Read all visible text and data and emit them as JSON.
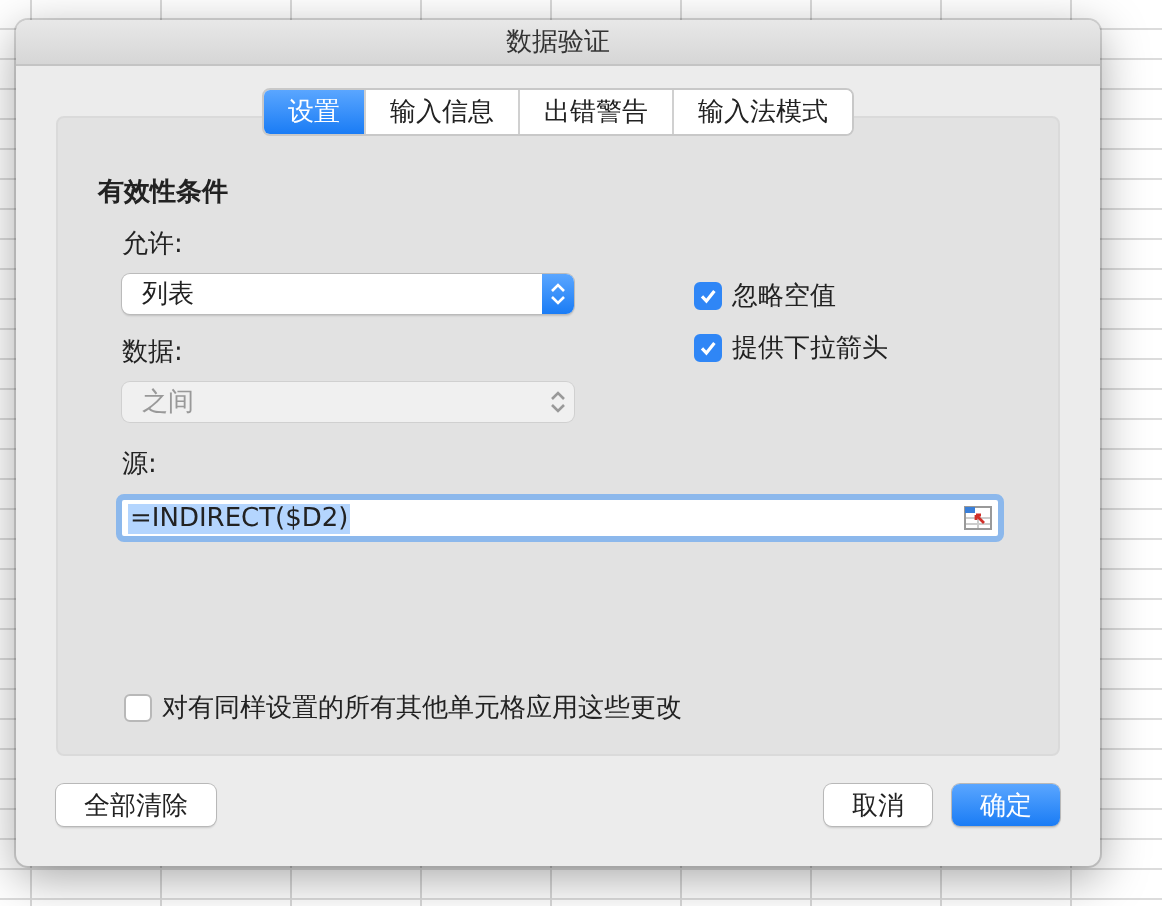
{
  "window": {
    "title": "数据验证"
  },
  "tabs": [
    {
      "label": "设置",
      "selected": true
    },
    {
      "label": "输入信息",
      "selected": false
    },
    {
      "label": "出错警告",
      "selected": false
    },
    {
      "label": "输入法模式",
      "selected": false
    }
  ],
  "section_title": "有效性条件",
  "allow": {
    "label": "允许:",
    "value": "列表",
    "disabled": false
  },
  "data": {
    "label": "数据:",
    "value": "之间",
    "disabled": true
  },
  "options": [
    {
      "label": "忽略空值",
      "checked": true
    },
    {
      "label": "提供下拉箭头",
      "checked": true
    }
  ],
  "source": {
    "label": "源:",
    "value": "=INDIRECT($D2)"
  },
  "apply_all": {
    "label": "对有同样设置的所有其他单元格应用这些更改",
    "checked": false
  },
  "buttons": [
    {
      "label": "全部清除",
      "kind": "default"
    },
    {
      "label": "取消",
      "kind": "default"
    },
    {
      "label": "确定",
      "kind": "primary"
    }
  ]
}
